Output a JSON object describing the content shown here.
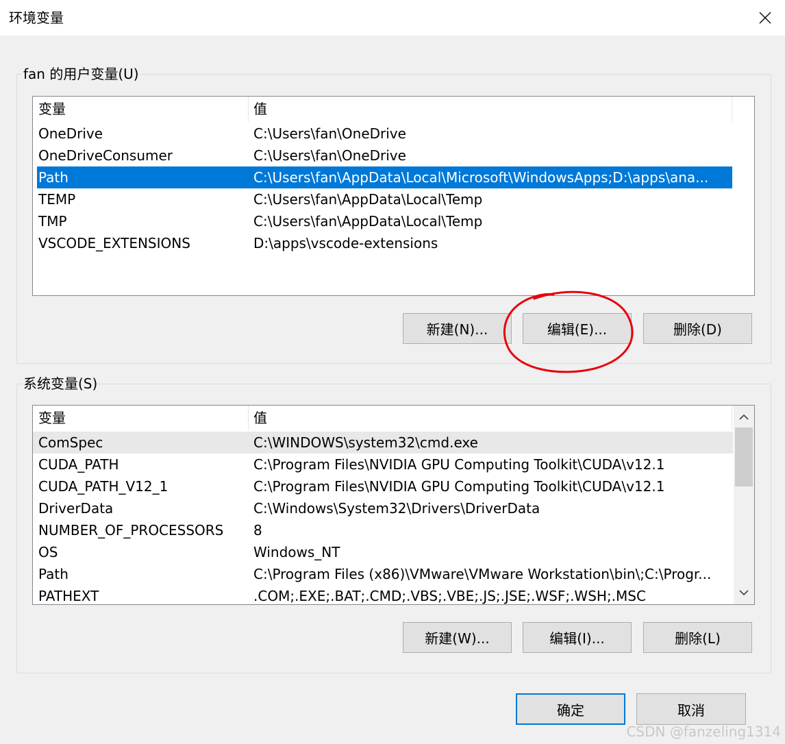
{
  "window": {
    "title": "环境变量"
  },
  "user_vars": {
    "group_label": "fan 的用户变量(U)",
    "columns": [
      "变量",
      "值"
    ],
    "rows": [
      {
        "name": "OneDrive",
        "value": "C:\\Users\\fan\\OneDrive"
      },
      {
        "name": "OneDriveConsumer",
        "value": "C:\\Users\\fan\\OneDrive"
      },
      {
        "name": "Path",
        "value": "C:\\Users\\fan\\AppData\\Local\\Microsoft\\WindowsApps;D:\\apps\\ana..."
      },
      {
        "name": "TEMP",
        "value": "C:\\Users\\fan\\AppData\\Local\\Temp"
      },
      {
        "name": "TMP",
        "value": "C:\\Users\\fan\\AppData\\Local\\Temp"
      },
      {
        "name": "VSCODE_EXTENSIONS",
        "value": "D:\\apps\\vscode-extensions"
      }
    ],
    "selected_row": "Path",
    "buttons": {
      "new": "新建(N)...",
      "edit": "编辑(E)...",
      "delete": "删除(D)"
    }
  },
  "system_vars": {
    "group_label": "系统变量(S)",
    "columns": [
      "变量",
      "值"
    ],
    "rows": [
      {
        "name": "ComSpec",
        "value": "C:\\WINDOWS\\system32\\cmd.exe"
      },
      {
        "name": "CUDA_PATH",
        "value": "C:\\Program Files\\NVIDIA GPU Computing Toolkit\\CUDA\\v12.1"
      },
      {
        "name": "CUDA_PATH_V12_1",
        "value": "C:\\Program Files\\NVIDIA GPU Computing Toolkit\\CUDA\\v12.1"
      },
      {
        "name": "DriverData",
        "value": "C:\\Windows\\System32\\Drivers\\DriverData"
      },
      {
        "name": "NUMBER_OF_PROCESSORS",
        "value": "8"
      },
      {
        "name": "OS",
        "value": "Windows_NT"
      },
      {
        "name": "Path",
        "value": "C:\\Program Files (x86)\\VMware\\VMware Workstation\\bin\\;C:\\Progr..."
      },
      {
        "name": "PATHEXT",
        "value": ".COM;.EXE;.BAT;.CMD;.VBS;.VBE;.JS;.JSE;.WSF;.WSH;.MSC"
      }
    ],
    "hot_row": "ComSpec",
    "buttons": {
      "new": "新建(W)...",
      "edit": "编辑(I)...",
      "delete": "删除(L)"
    }
  },
  "footer": {
    "ok": "确定",
    "cancel": "取消"
  },
  "watermark": "CSDN @fanzeling1314",
  "icons": {
    "close": "close-icon",
    "scroll_up": "chevron-up-icon",
    "scroll_down": "chevron-down-icon"
  },
  "colors": {
    "selection": "#0078d7",
    "annotation": "#e8000b",
    "default_button_border": "#0078d7"
  }
}
